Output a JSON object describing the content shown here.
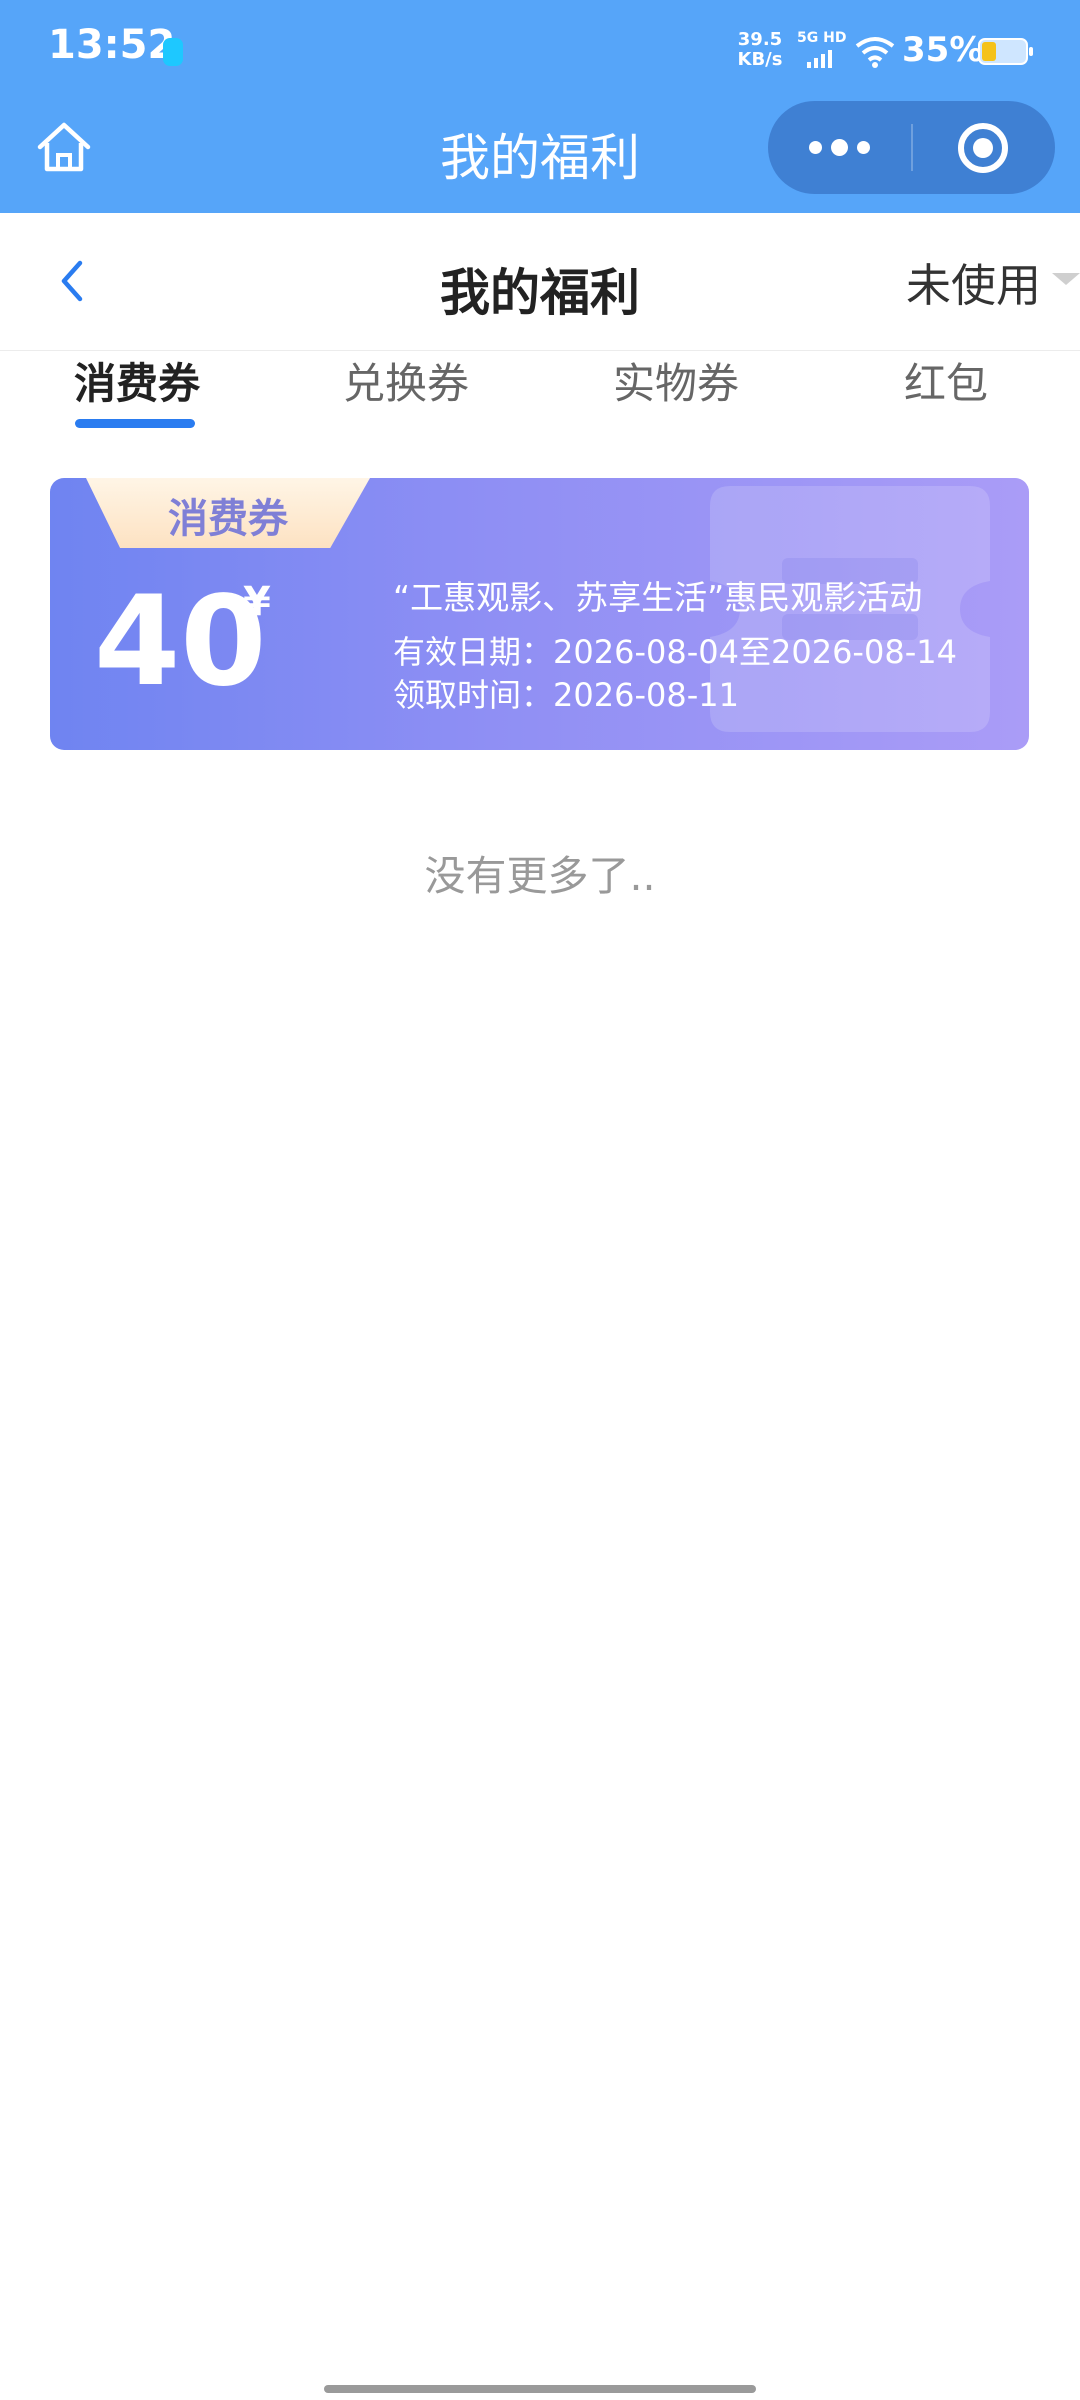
{
  "status_bar": {
    "time": "13:52",
    "net_speed_value": "39.5",
    "net_speed_unit": "KB/s",
    "network_type": "5G HD",
    "battery_percent": "35%",
    "battery_level": 0.35,
    "icons": [
      "notification-dot-icon",
      "signal-icon",
      "wifi-icon",
      "battery-icon"
    ]
  },
  "miniprogram_header": {
    "title": "我的福利",
    "home_icon": "home-icon",
    "more_icon": "more-dots-icon",
    "close_icon": "target-close-icon"
  },
  "navbar": {
    "title": "我的福利",
    "back_icon": "chevron-left-icon",
    "filter_label": "未使用",
    "filter_icon": "caret-down-icon"
  },
  "tabs": [
    {
      "label": "消费券",
      "active": true
    },
    {
      "label": "兑换券",
      "active": false
    },
    {
      "label": "实物券",
      "active": false
    },
    {
      "label": "红包",
      "active": false
    }
  ],
  "coupons": [
    {
      "badge": "消费券",
      "amount": "40",
      "currency": "¥",
      "name": "“工惠观影、苏享生活”惠民观影活动",
      "validity_label": "有效日期：",
      "validity": "2026-08-04至2026-08-14",
      "received_label": "领取时间：",
      "received": "2026-08-11"
    }
  ],
  "list_footer": "没有更多了..",
  "colors": {
    "header_blue": "#56a5f9",
    "capsule_blue": "#3f80d3",
    "tab_indicator": "#2a7cf0",
    "coupon_gradient_start": "#6f84f1",
    "coupon_gradient_end": "#aa9cf7",
    "badge_text": "#7f7fd6"
  }
}
